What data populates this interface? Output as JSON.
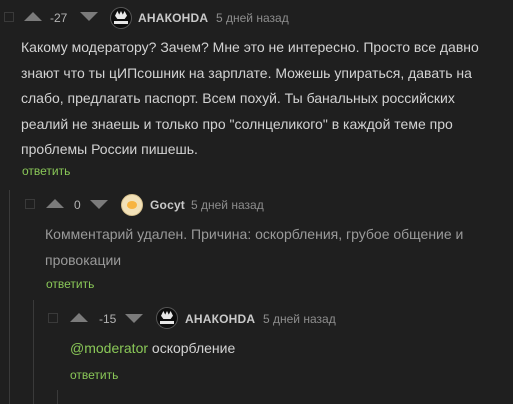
{
  "comments": [
    {
      "rating": "-27",
      "author": "АНАКОНDA",
      "time": "5 дней назад",
      "lines": [
        "Какому модератору? Зачем? Мне это не интересно. Просто все давно",
        "знают что ты цИПсошник на зарплате. Можешь упираться, давать на",
        "слабо, предлагать паспорт. Всем похуй. Ты банальных российских",
        "реалий не знаешь и только про \"солнцеликого\" в каждой теме про",
        "проблемы России пишешь."
      ],
      "reply_label": "ответить"
    },
    {
      "rating": "0",
      "author": "Gocyt",
      "time": "5 дней назад",
      "lines": [
        "Комментарий удален. Причина: оскорбления, грубое общение и",
        "провокации"
      ],
      "reply_label": "ответить"
    },
    {
      "rating": "-15",
      "author": "АНАКОНDA",
      "time": "5 дней назад",
      "mention": "@moderator",
      "text": " оскорбление",
      "reply_label": "ответить"
    }
  ],
  "colors": {
    "background": "#1f1f1f",
    "reply_link": "#8ac858",
    "mention": "#8ac858",
    "vote_arrow": "#7b7b7b"
  },
  "icons": {
    "vote_up": "triangle-up",
    "vote_down": "triangle-down",
    "collapse": "square-outline"
  }
}
